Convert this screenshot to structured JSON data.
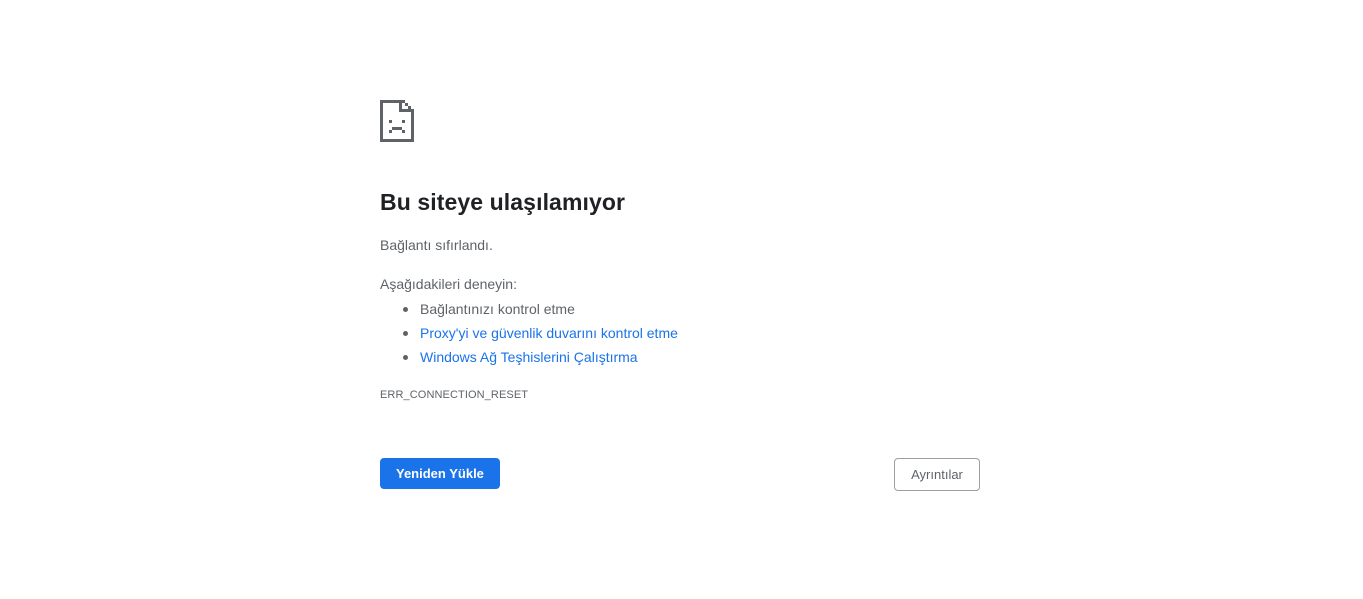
{
  "error": {
    "icon": "sad-document-icon",
    "title": "Bu siteye ulaşılamıyor",
    "summary": "Bağlantı sıfırlandı.",
    "try_heading": "Aşağıdakileri deneyin:",
    "suggestions": [
      {
        "label": "Bağlantınızı kontrol etme",
        "is_link": false
      },
      {
        "label": "Proxy'yi ve güvenlik duvarını kontrol etme",
        "is_link": true
      },
      {
        "label": "Windows Ağ Teşhislerini Çalıştırma",
        "is_link": true
      }
    ],
    "code": "ERR_CONNECTION_RESET"
  },
  "buttons": {
    "reload_label": "Yeniden Yükle",
    "details_label": "Ayrıntılar"
  },
  "colors": {
    "accent": "#1a73e8",
    "title": "#202124",
    "text": "#5f6368",
    "background": "#ffffff"
  }
}
